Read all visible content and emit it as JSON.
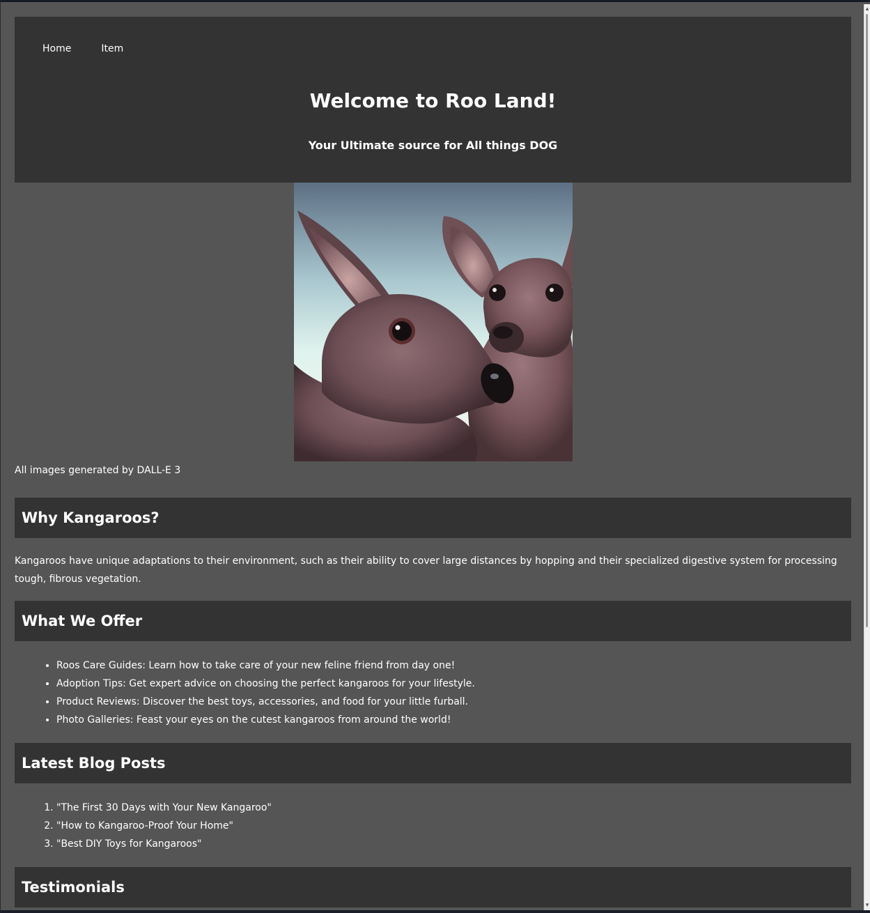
{
  "nav": {
    "items": [
      {
        "label": "Home"
      },
      {
        "label": "Item"
      }
    ]
  },
  "hero": {
    "title": "Welcome to Roo Land!",
    "subtitle": "Your Ultimate source for All things DOG"
  },
  "image": {
    "subject": "two kangaroos",
    "credit": "All images generated by DALL-E 3"
  },
  "why": {
    "heading": "Why Kangaroos?",
    "body": "Kangaroos have unique adaptations to their environment, such as their ability to cover large distances by hopping and their specialized digestive system for processing tough, fibrous vegetation."
  },
  "offer": {
    "heading": "What We Offer",
    "items": [
      "Roos Care Guides: Learn how to take care of your new feline friend from day one!",
      "Adoption Tips: Get expert advice on choosing the perfect kangaroos for your lifestyle.",
      "Product Reviews: Discover the best toys, accessories, and food for your little furball.",
      "Photo Galleries: Feast your eyes on the cutest kangaroos from around the world!"
    ]
  },
  "blog": {
    "heading": "Latest Blog Posts",
    "posts": [
      "\"The First 30 Days with Your New Kangaroo\"",
      "\"How to Kangaroo-Proof Your Home\"",
      "\"Best DIY Toys for Kangaroos\""
    ]
  },
  "testimonials": {
    "heading": "Testimonials"
  },
  "colors": {
    "page_bg": "#555555",
    "panel_bg": "#333333",
    "text": "#ffffff"
  }
}
